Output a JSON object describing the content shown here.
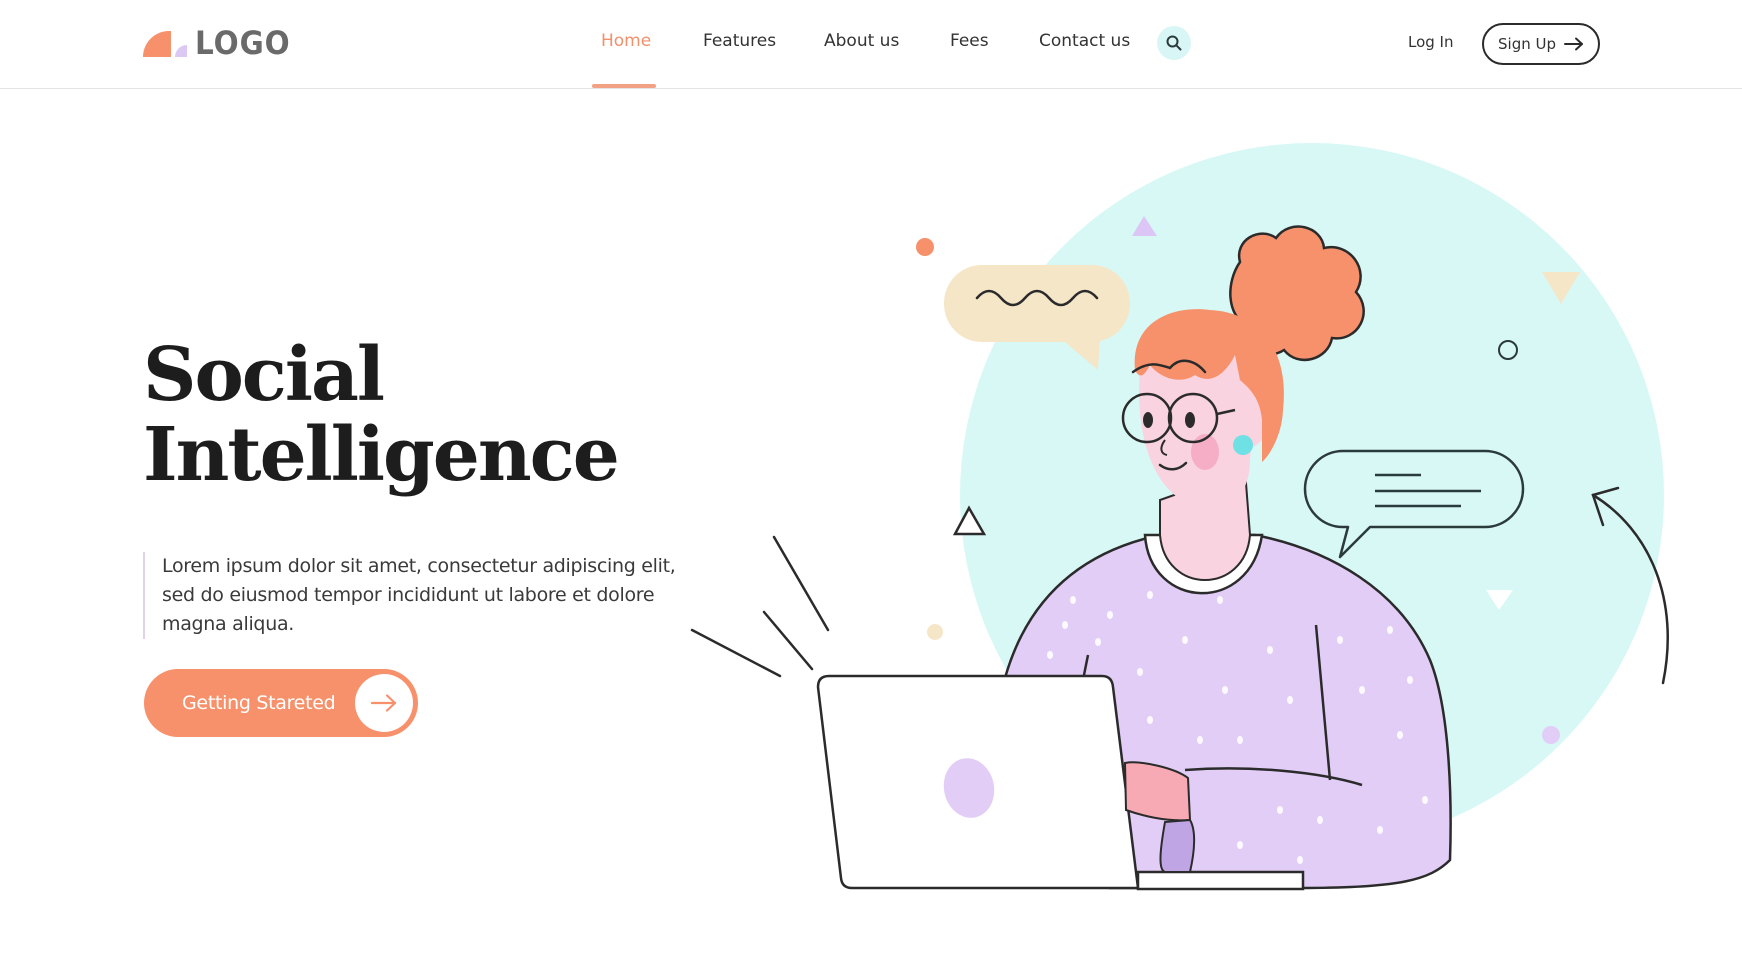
{
  "header": {
    "logo_text": "LOGO",
    "nav": [
      {
        "label": "Home",
        "active": true
      },
      {
        "label": "Features",
        "active": false
      },
      {
        "label": "About us",
        "active": false
      },
      {
        "label": "Fees",
        "active": false
      },
      {
        "label": "Contact us",
        "active": false
      }
    ],
    "search_icon": "search-icon",
    "login_label": "Log In",
    "signup_label": "Sign Up",
    "signup_icon": "arrow-right-icon"
  },
  "hero": {
    "title_line1": "Social",
    "title_line2": "Intelligence",
    "description": "Lorem ipsum dolor sit amet, consectetur adipiscing elit, sed do eiusmod tempor incididunt ut labore et dolore magna aliqua.",
    "cta_label": "Getting Stareted",
    "cta_icon": "arrow-right-icon"
  },
  "illustration": {
    "subject": "woman-with-glasses-using-laptop",
    "elements": [
      "background-circle",
      "speech-bubble-wavy",
      "speech-bubble-lines",
      "curved-arrow",
      "laptop",
      "decorative-shapes"
    ]
  },
  "colors": {
    "accent": "#f7916b",
    "accent_light": "#f2a184",
    "mint": "#d8f8f6",
    "lavender": "#e2cdf7",
    "cream": "#f6e6c8",
    "text_dark": "#1d1d1d"
  }
}
